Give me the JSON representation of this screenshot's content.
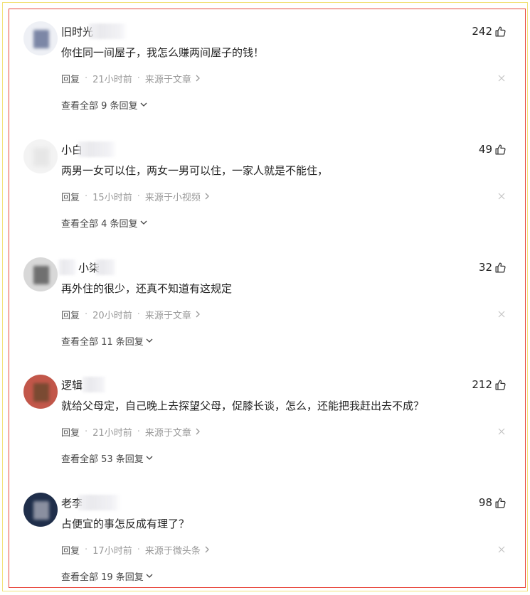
{
  "comments": [
    {
      "username": "旧时光",
      "likes": "242",
      "text": "你住同一间屋子，我怎么赚两间屋子的钱！",
      "reply_label": "回复",
      "time": "21小时前",
      "source": "来源于文章",
      "view_replies": "查看全部 9 条回复",
      "avatar_colors": [
        "#eef0f5",
        "#7c87a6"
      ]
    },
    {
      "username": "小白",
      "likes": "49",
      "text": "两男一女可以住，两女一男可以住，一家人就是不能住，",
      "reply_label": "回复",
      "time": "15小时前",
      "source": "来源于小视频",
      "view_replies": "查看全部 4 条回复",
      "avatar_colors": [
        "#f3f3f3",
        "#e6e6e6"
      ]
    },
    {
      "username": "小柒",
      "likes": "32",
      "text": "再外住的很少，还真不知道有这规定",
      "reply_label": "回复",
      "time": "20小时前",
      "source": "来源于文章",
      "view_replies": "查看全部 11 条回复",
      "avatar_colors": [
        "#d8d8d8",
        "#707070"
      ]
    },
    {
      "username": "逻辑",
      "likes": "212",
      "text": "就给父母定，自己晚上去探望父母，促膝长谈，怎么，还能把我赶出去不成？",
      "reply_label": "回复",
      "time": "21小时前",
      "source": "来源于文章",
      "view_replies": "查看全部 53 条回复",
      "avatar_colors": [
        "#c2574a",
        "#7a4a32"
      ]
    },
    {
      "username": "老李",
      "likes": "98",
      "text": "占便宜的事怎反成有理了？",
      "reply_label": "回复",
      "time": "17小时前",
      "source": "来源于微头条",
      "view_replies": "查看全部 19 条回复",
      "avatar_colors": [
        "#1f2e4a",
        "#8a8fa0"
      ]
    }
  ],
  "separator": "·",
  "colors": {
    "frame_outer": "#f2e27a",
    "frame_inner": "#e8473c",
    "text_primary": "#222222",
    "text_meta": "#999999",
    "text_reply_link": "#555555"
  },
  "icons": {
    "like": "thumbs-up-icon",
    "close": "close-icon",
    "chevron_right": "chevron-right-icon",
    "chevron_down": "chevron-down-icon"
  }
}
